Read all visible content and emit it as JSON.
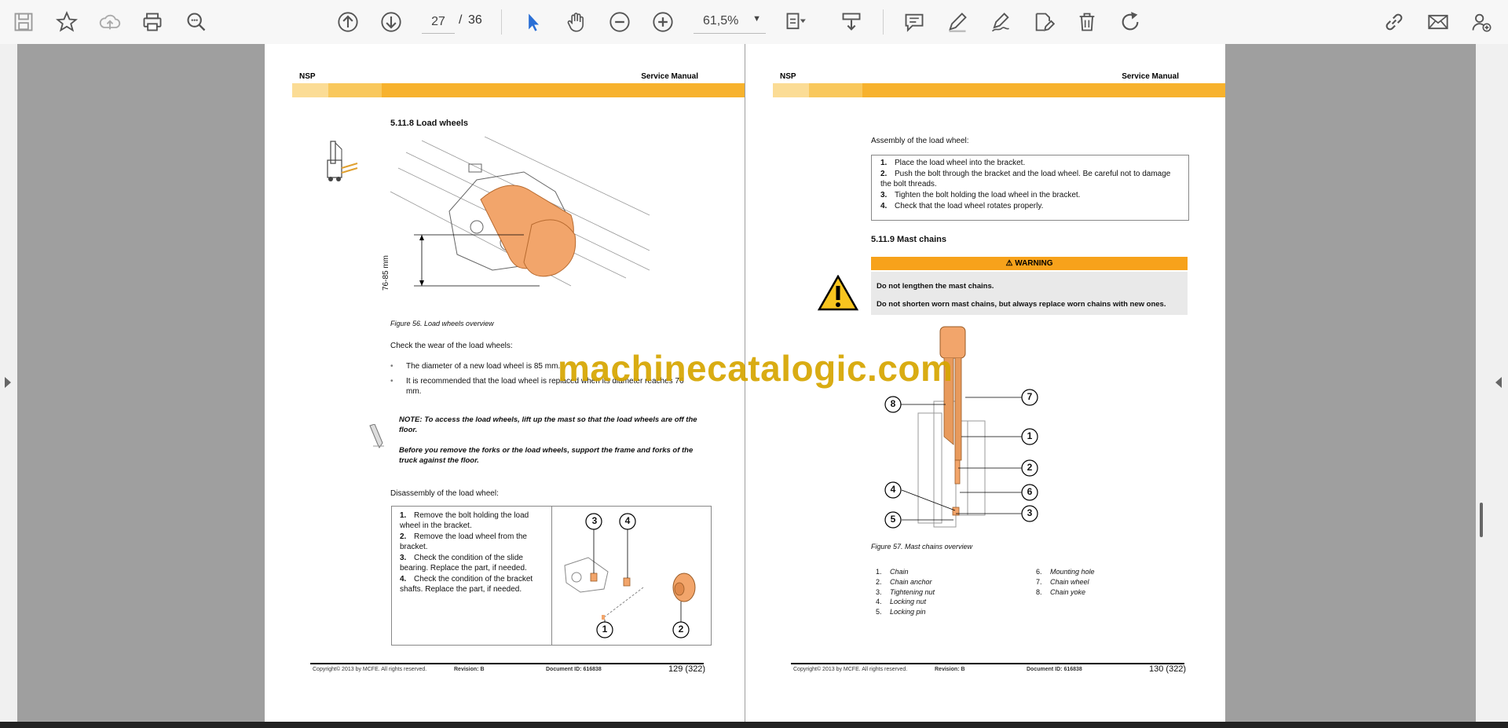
{
  "toolbar": {
    "current_page": "27",
    "page_separator": "/",
    "total_pages": "36",
    "zoom": "61,5%",
    "icons": [
      "save-icon",
      "star-icon",
      "cloud-upload-icon",
      "print-icon",
      "zoom-search-icon",
      "page-up-icon",
      "page-down-icon",
      "select-arrow-icon",
      "hand-tool-icon",
      "zoom-out-icon",
      "zoom-in-icon",
      "fit-page-icon",
      "download-icon",
      "comment-icon",
      "pen-icon",
      "sign-icon",
      "edit-icon",
      "delete-icon",
      "rotate-icon",
      "share-link-icon",
      "email-icon",
      "add-user-icon"
    ]
  },
  "left_page": {
    "header_left": "NSP",
    "header_right": "Service Manual",
    "section_title": "5.11.8    Load wheels",
    "fig_dim_label": "76-85 mm",
    "figure_caption": "Figure 56. Load wheels overview",
    "check_wear": "Check the wear of the load wheels:",
    "bullets": [
      "The diameter of a new load wheel is 85 mm.",
      "It is recommended that the load wheel is replaced when its diameter reaches 76 mm."
    ],
    "note1": "NOTE: To access the load wheels, lift up the mast so that the load wheels are off the floor.",
    "note2": "Before you remove the forks or the load wheels, support the frame and forks of the truck against the floor.",
    "disassembly_title": "Disassembly of the load wheel:",
    "steps": [
      {
        "n": "1.",
        "t": "Remove the bolt holding the load wheel in the bracket."
      },
      {
        "n": "2.",
        "t": "Remove the load wheel from the bracket."
      },
      {
        "n": "3.",
        "t": "Check the condition of the slide bearing. Replace the part, if needed."
      },
      {
        "n": "4.",
        "t": "Check the condition of the bracket shafts. Replace the part, if needed."
      }
    ],
    "callouts": [
      "3",
      "4",
      "1",
      "2"
    ],
    "footer_copyright": "Copyright© 2013 by MCFE. All rights reserved.",
    "footer_revision": "Revision: B",
    "footer_doc": "Document ID: 616838",
    "page_number": "129 (322)"
  },
  "right_page": {
    "header_left": "NSP",
    "header_right": "Service Manual",
    "assembly_title": "Assembly of the load wheel:",
    "steps": [
      {
        "n": "1.",
        "t": "Place the load wheel into the bracket."
      },
      {
        "n": "2.",
        "t": "Push the bolt through the bracket and the load wheel. Be careful not to damage the bolt threads."
      },
      {
        "n": "3.",
        "t": "Tighten the bolt holding the load wheel in the bracket."
      },
      {
        "n": "4.",
        "t": "Check that the load wheel rotates properly."
      }
    ],
    "section_title": "5.11.9    Mast chains",
    "warning_label": "WARNING",
    "warning_1": "Do not lengthen the mast chains.",
    "warning_2": "Do not shorten worn mast chains, but always replace worn chains with new ones.",
    "callouts": [
      "8",
      "7",
      "1",
      "2",
      "6",
      "4",
      "3",
      "5"
    ],
    "figure_caption": "Figure 57. Mast chains overview",
    "legend_left": [
      {
        "n": "1.",
        "t": "Chain"
      },
      {
        "n": "2.",
        "t": "Chain anchor"
      },
      {
        "n": "3.",
        "t": "Tightening nut"
      },
      {
        "n": "4.",
        "t": "Locking nut"
      },
      {
        "n": "5.",
        "t": "Locking pin"
      }
    ],
    "legend_right": [
      {
        "n": "6.",
        "t": "Mounting hole"
      },
      {
        "n": "7.",
        "t": "Chain wheel"
      },
      {
        "n": "8.",
        "t": "Chain yoke"
      }
    ],
    "footer_copyright": "Copyright© 2013 by MCFE. All rights reserved.",
    "footer_revision": "Revision: B",
    "footer_doc": "Document ID: 616838",
    "page_number": "130 (322)"
  },
  "watermark": "machinecatalogic.com",
  "colors": {
    "accent_band": "#f7b22d",
    "warning": "#f7a21b",
    "wheel": "#f2a56b",
    "watermark": "#d6a500"
  }
}
